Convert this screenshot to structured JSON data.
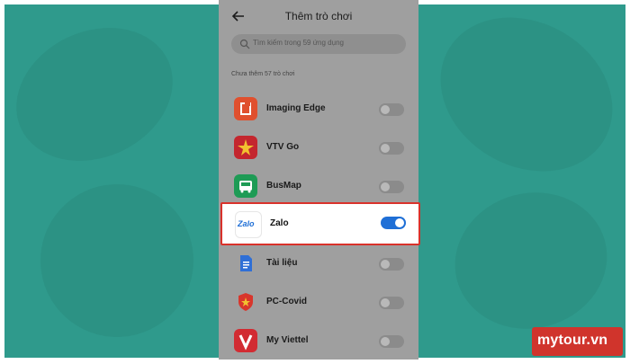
{
  "header": {
    "title": "Thêm trò chơi"
  },
  "search": {
    "placeholder": "Tìm kiếm trong 59 ứng dụng"
  },
  "section": {
    "label": "Chưa thêm 57 trò chơi"
  },
  "apps": [
    {
      "name": "Imaging Edge",
      "icon": "imaging-edge-icon",
      "color": "#e0502e",
      "enabled": false
    },
    {
      "name": "VTV Go",
      "icon": "vtv-go-icon",
      "color": "#c4262e",
      "enabled": false
    },
    {
      "name": "BusMap",
      "icon": "busmap-icon",
      "color": "#1e9b55",
      "enabled": false
    },
    {
      "name": "Zalo",
      "icon": "zalo-icon",
      "color": "#1f6fd6",
      "enabled": true,
      "highlighted": true
    },
    {
      "name": "Tài liệu",
      "icon": "docs-icon",
      "color": "#2f6fd6",
      "enabled": false
    },
    {
      "name": "PC-Covid",
      "icon": "pc-covid-icon",
      "color": "#d8362c",
      "enabled": false
    },
    {
      "name": "My Viettel",
      "icon": "my-viettel-icon",
      "color": "#d22b32",
      "enabled": false
    }
  ],
  "zalo_logo_text": "Zalo",
  "watermark": {
    "text": "mytour.vn"
  },
  "colors": {
    "background": "#2f9a8c",
    "highlight_border": "#d9322b",
    "toggle_on": "#1f6fd6"
  }
}
